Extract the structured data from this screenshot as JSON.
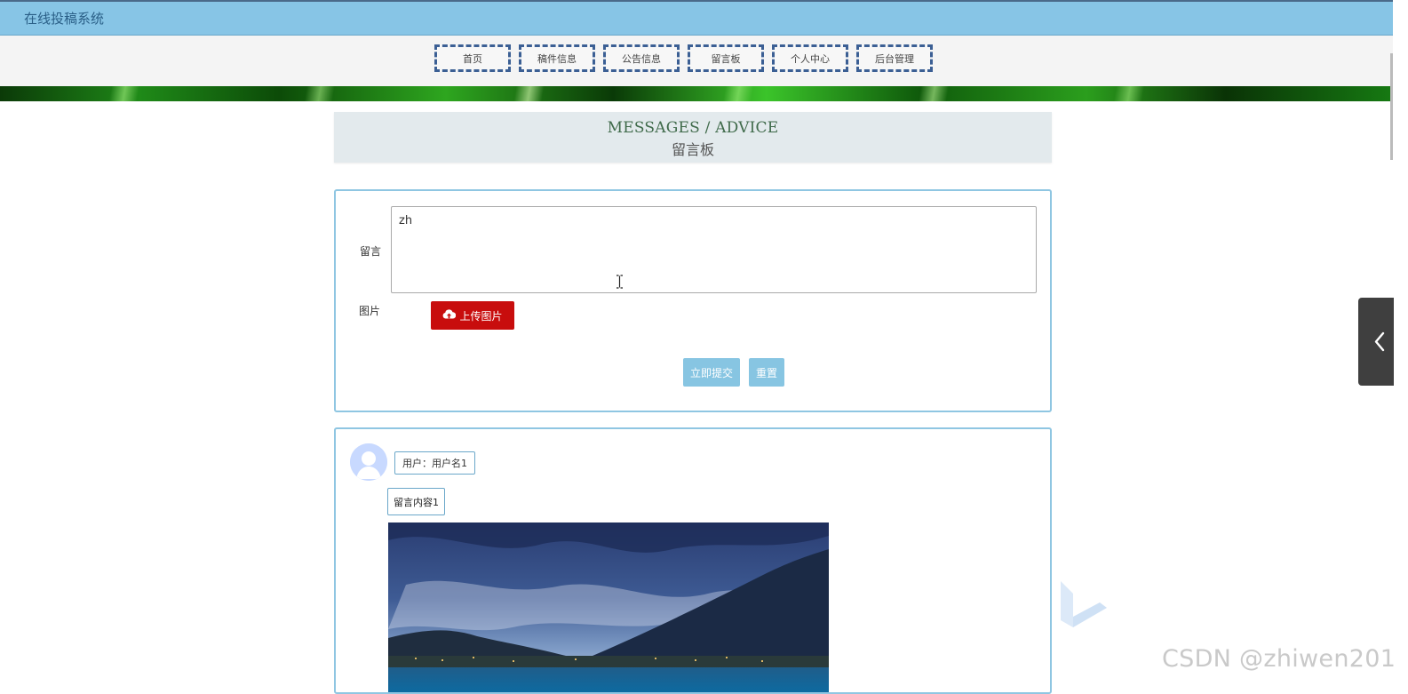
{
  "header": {
    "site_title": "在线投稿系统"
  },
  "nav": {
    "items": [
      {
        "label": "首页"
      },
      {
        "label": "稿件信息"
      },
      {
        "label": "公告信息"
      },
      {
        "label": "留言板"
      },
      {
        "label": "个人中心"
      },
      {
        "label": "后台管理"
      }
    ]
  },
  "section_heading": {
    "en": "MESSAGES / ADVICE",
    "zh": "留言板"
  },
  "form": {
    "message_label": "留言",
    "message_value": "zh",
    "image_label": "图片",
    "upload_label": "上传图片",
    "submit_label": "立即提交",
    "reset_label": "重置"
  },
  "messages": [
    {
      "user": "用户：用户名1",
      "content": "留言内容1"
    }
  ],
  "watermark": "CSDN @zhiwen201",
  "icons": {
    "upload": "cloud-upload-icon",
    "side_toggle": "chevron-left-icon"
  }
}
